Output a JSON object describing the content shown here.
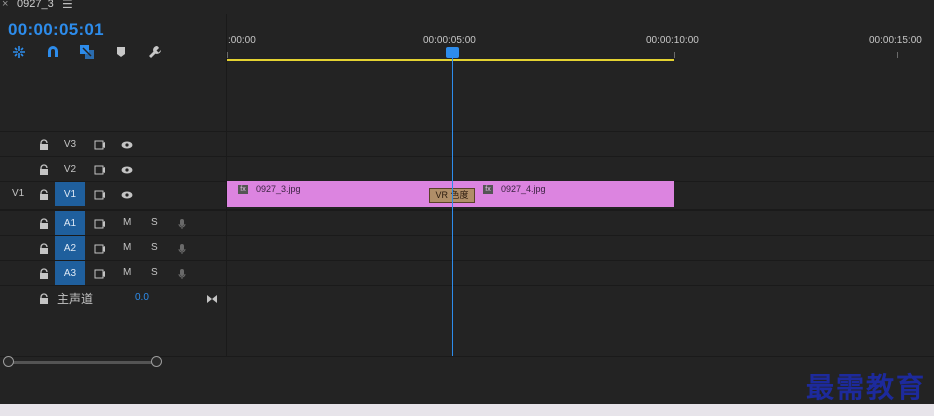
{
  "window": {
    "close_glyph": "×",
    "sequence_name": "0927_3",
    "menu_glyph": "☰"
  },
  "timecode": "00:00:05:01",
  "toolbar": {
    "icons": [
      "snap-icon",
      "magnet-icon",
      "linked-selection-icon",
      "add-marker-icon",
      "wrench-icon"
    ]
  },
  "ruler": {
    "labels": [
      ":00:00",
      "00:00:05:00",
      "00:00:10:00",
      "00:00:15:00"
    ]
  },
  "tracks": {
    "v3": {
      "label": "V3"
    },
    "v2": {
      "label": "V2"
    },
    "v1": {
      "label": "V1",
      "source_label": "V1"
    },
    "a1": {
      "label": "A1",
      "mute": "M",
      "solo": "S"
    },
    "a2": {
      "label": "A2",
      "mute": "M",
      "solo": "S"
    },
    "a3": {
      "label": "A3",
      "mute": "M",
      "solo": "S"
    },
    "master": {
      "label": "主声道",
      "value": "0.0"
    }
  },
  "clips": [
    {
      "name": "0927_3.jpg",
      "fx": "fx"
    },
    {
      "name": "0927_4.jpg",
      "fx": "fx"
    }
  ],
  "transition": {
    "label": "VR 色度"
  },
  "watermark": "最需教育",
  "colors": {
    "accent": "#2d8ceb",
    "clip": "#dc84e0",
    "work_area": "#e4d231",
    "track_on": "#1f5f9d"
  }
}
